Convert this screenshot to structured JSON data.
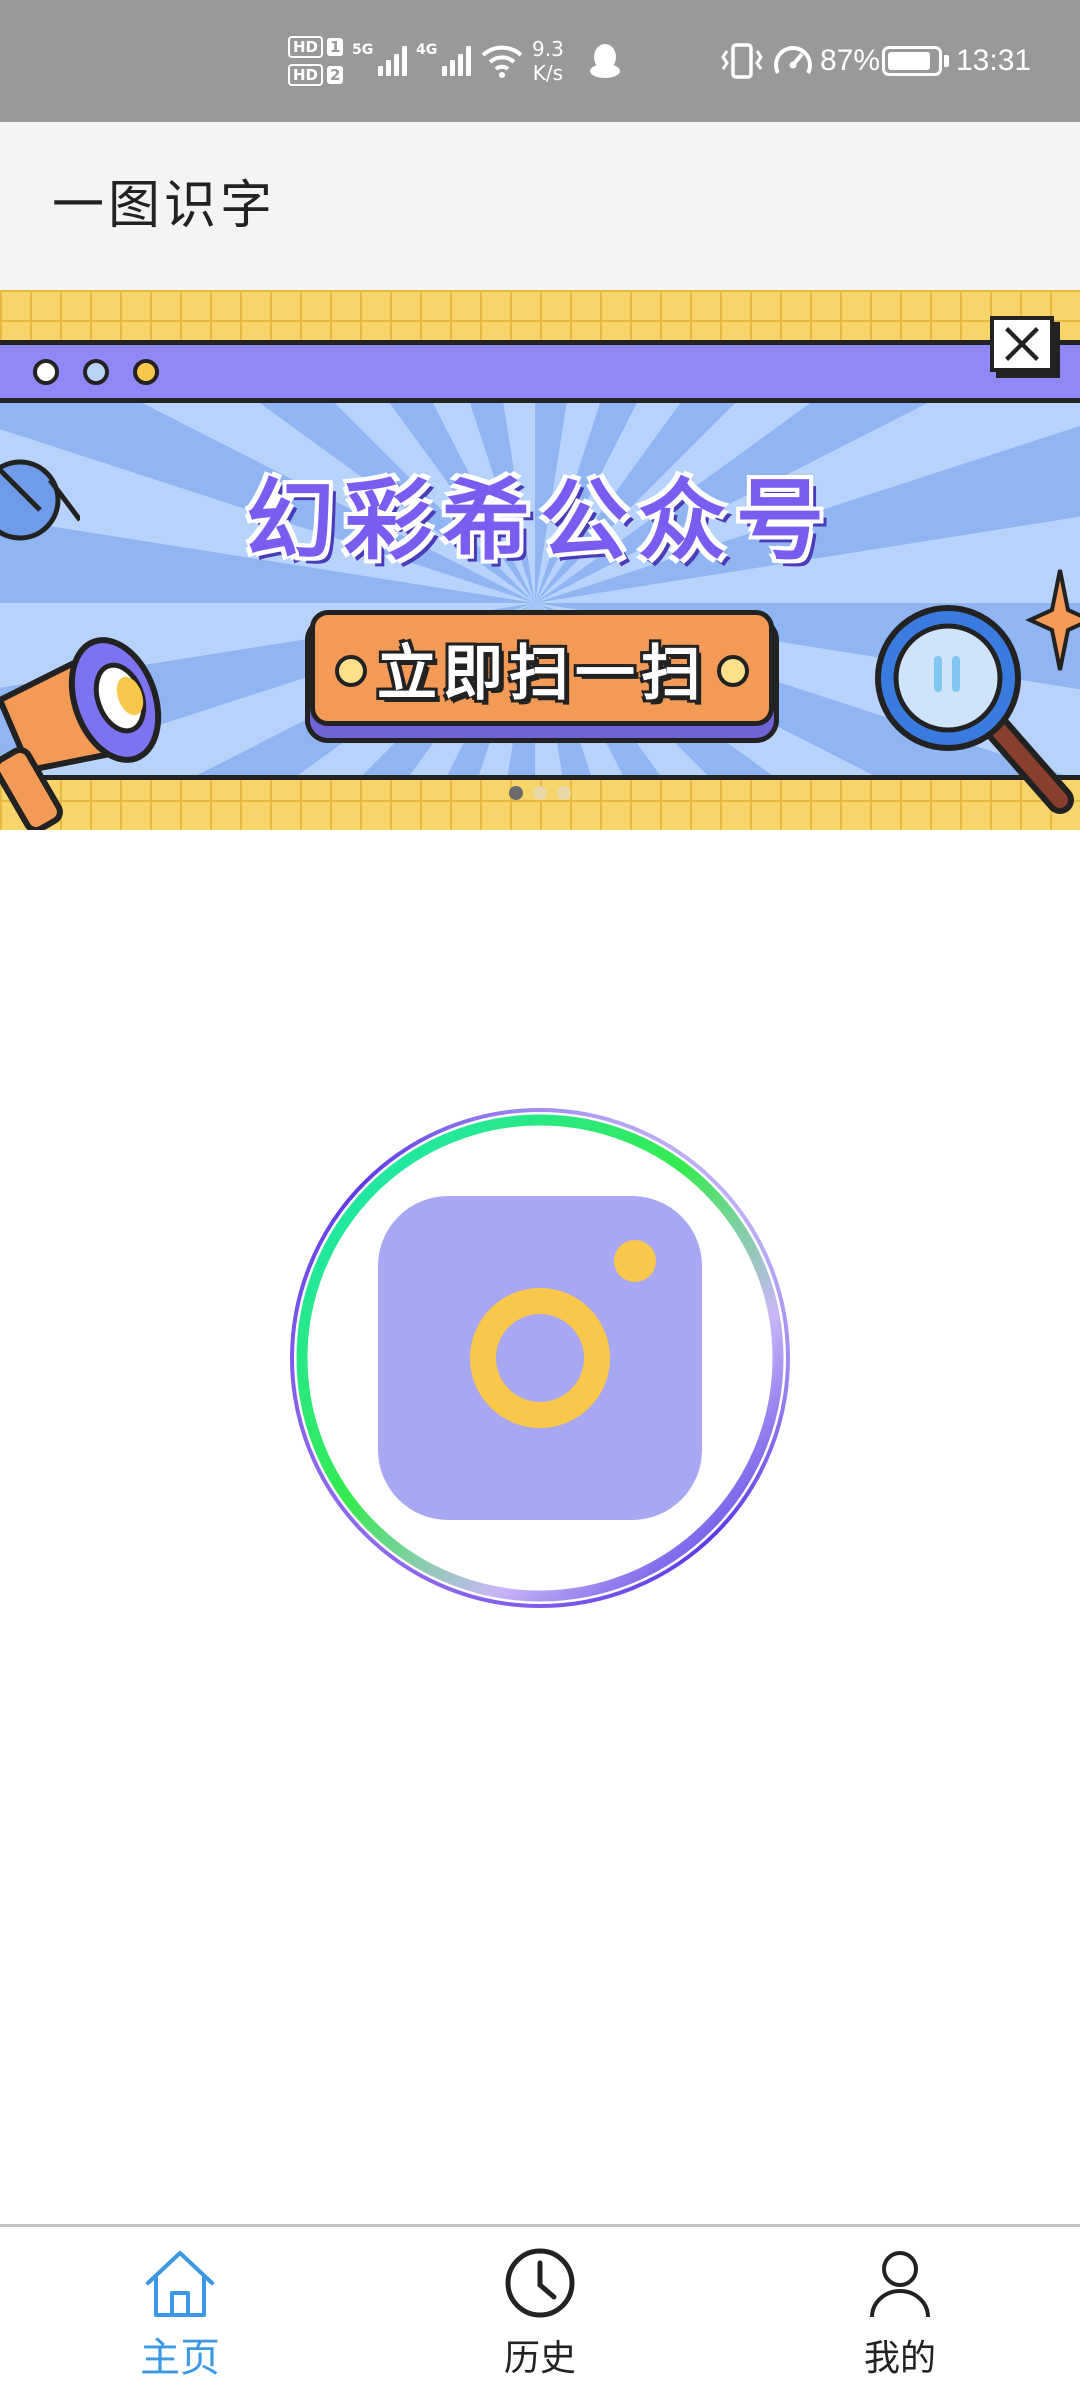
{
  "status_bar": {
    "hd1": "HD",
    "sim1": "1",
    "hd2": "HD",
    "sim2": "2",
    "net1": "5G",
    "net2": "4G",
    "speed_value": "9.3",
    "speed_unit": "K/s",
    "battery_percent": "87%",
    "battery_level": 0.87,
    "time": "13:31",
    "icons": [
      "signal-icon",
      "wifi-icon",
      "qq-icon",
      "vibrate-icon",
      "speedometer-icon",
      "battery-icon"
    ]
  },
  "app_bar": {
    "title": "一图识字"
  },
  "banner": {
    "title": "幻彩希公众号",
    "button_label": "立即扫一扫",
    "page_count": 3,
    "active_page": 1,
    "colors": {
      "grid": "#f8d56a",
      "window_bar": "#8f88f6",
      "button": "#f39a57",
      "title": "#7b5cf0"
    }
  },
  "camera": {
    "icon": "camera-icon",
    "ring_gradient": [
      "#18e7c6",
      "#35ea4e",
      "#c9b6f7",
      "#3a1fe0"
    ],
    "icon_bg": "#a7a7f3",
    "lens_color": "#f9c74a"
  },
  "bottom_nav": {
    "items": [
      {
        "label": "主页",
        "icon": "home-icon",
        "active": true
      },
      {
        "label": "历史",
        "icon": "clock-icon",
        "active": false
      },
      {
        "label": "我的",
        "icon": "user-icon",
        "active": false
      }
    ],
    "active_color": "#3a98e6"
  }
}
